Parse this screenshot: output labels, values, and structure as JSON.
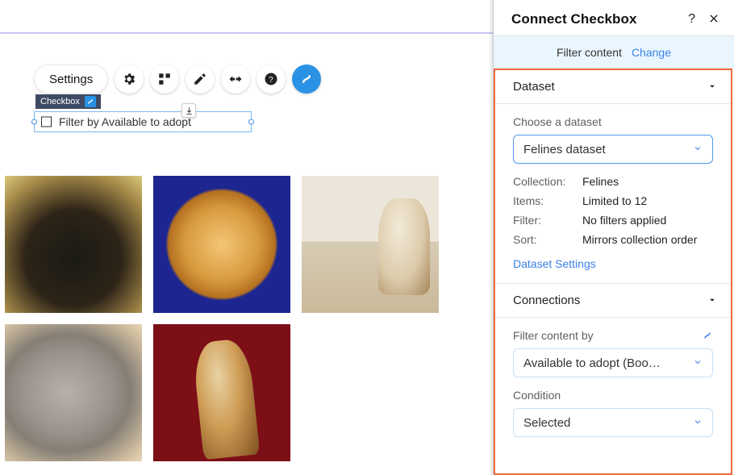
{
  "toolbar": {
    "settings_label": "Settings"
  },
  "checkbox_widget": {
    "tag_label": "Checkbox",
    "label_text": "Filter by Available to adopt"
  },
  "panel": {
    "title": "Connect Checkbox",
    "filter_content": {
      "text": "Filter content",
      "change_label": "Change"
    },
    "dataset": {
      "heading": "Dataset",
      "choose_label": "Choose a dataset",
      "selected": "Felines dataset",
      "collection_label": "Collection:",
      "collection_value": "Felines",
      "items_label": "Items:",
      "items_value": "Limited to 12",
      "filter_label": "Filter:",
      "filter_value": "No filters applied",
      "sort_label": "Sort:",
      "sort_value": "Mirrors collection order",
      "settings_link": "Dataset Settings"
    },
    "connections": {
      "heading": "Connections",
      "filter_by_label": "Filter content by",
      "filter_by_value": "Available to adopt (Boo…",
      "condition_label": "Condition",
      "condition_value": "Selected"
    }
  }
}
